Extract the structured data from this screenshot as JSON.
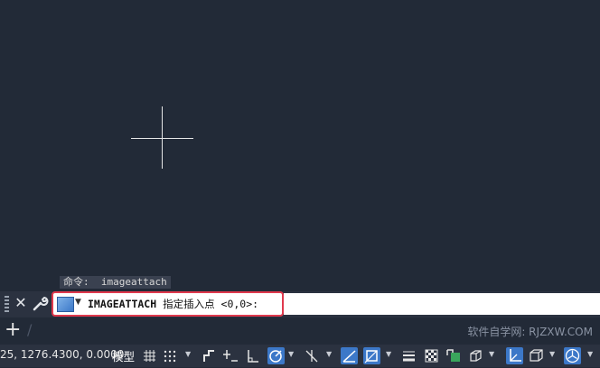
{
  "command_history": {
    "line": "命令:  imageattach"
  },
  "command_line": {
    "command": "IMAGEATTACH",
    "prompt": " 指定插入点 <0,0>:"
  },
  "layout_tabs": {
    "add_symbol": "+",
    "separator": "/"
  },
  "watermark": "软件自学网: RJZXW.COM",
  "status_bar": {
    "coordinates": "25, 1276.4300, 0.0000",
    "model_tab": "模型",
    "icons": [
      "grid-icon",
      "snap-icon",
      "snap-mode-dropdown",
      "infer-constraints-icon",
      "dynamic-input-icon",
      "ortho-icon",
      "polar-tracking-icon",
      "polar-dropdown",
      "isometric-draft-icon",
      "isometric-dropdown",
      "object-snap-tracking-icon",
      "object-snap-icon",
      "object-snap-dropdown",
      "lineweight-icon",
      "transparency-icon",
      "selection-cycling-icon",
      "3d-osnap-icon",
      "3d-osnap-dropdown",
      "dynamic-ucs-icon",
      "selection-filter-icon",
      "selection-filter-dropdown",
      "gizmo-icon",
      "gizmo-dropdown"
    ],
    "active_color": "#3c78c8"
  },
  "colors": {
    "canvas": "#222a37",
    "input_border": "#e0394d",
    "crosshair": "#e6e6e6"
  }
}
